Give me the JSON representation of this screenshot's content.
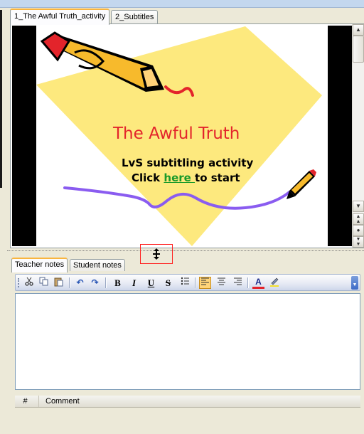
{
  "slide_tabs": [
    {
      "label": "1_The Awful Truth_activity",
      "active": true
    },
    {
      "label": "2_Subtitles",
      "active": false
    }
  ],
  "slide": {
    "title": "The Awful Truth",
    "subtitle": "LvS subtitling activity",
    "cta_prefix": "Click ",
    "cta_link": "here ",
    "cta_suffix": "to start"
  },
  "notes_tabs": [
    {
      "label": "Teacher notes",
      "active": true
    },
    {
      "label": "Student notes",
      "active": false
    }
  ],
  "toolbar": {
    "buttons": [
      "cut-icon",
      "copy-icon",
      "paste-icon",
      "undo-icon",
      "redo-icon",
      "bold-icon",
      "italic-icon",
      "underline-icon",
      "strikethrough-icon",
      "bullet-list-icon",
      "align-left-icon",
      "align-center-icon",
      "align-right-icon",
      "font-color-icon",
      "highlight-icon"
    ],
    "bold_glyph": "B",
    "italic_glyph": "I",
    "underline_glyph": "U",
    "strike_glyph": "S",
    "font_color_glyph": "A",
    "active_alignment": "left"
  },
  "notes_text": "",
  "comments": {
    "columns": [
      "#",
      "Comment"
    ],
    "rows": []
  },
  "colors": {
    "title_red": "#e3242b",
    "link_green": "#1a9a2a",
    "wave_purple": "#8a5cf0",
    "diamond_yellow": "#fde97e",
    "tab_highlight": "#f9b53f"
  }
}
